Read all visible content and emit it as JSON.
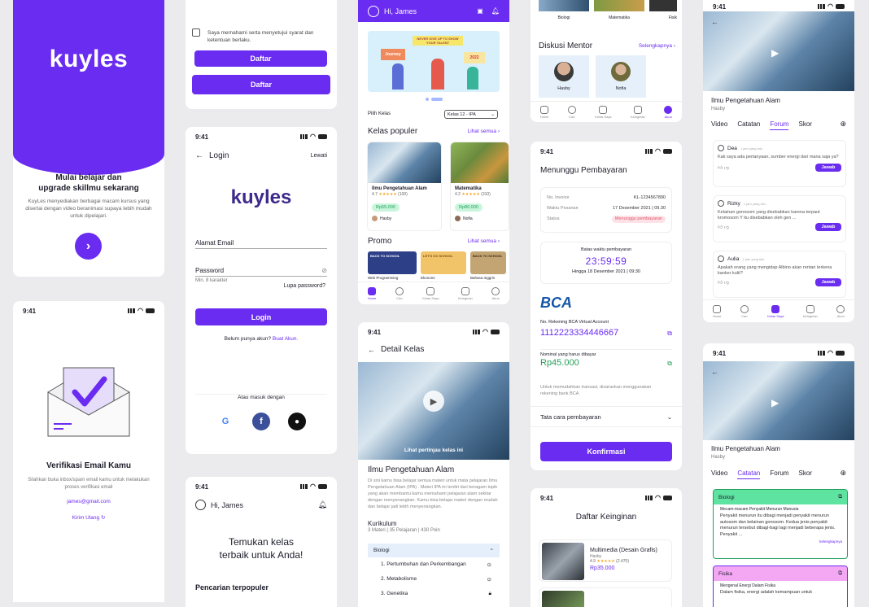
{
  "brand": {
    "logo_text": "kuyles",
    "primary": "#6a2cf1"
  },
  "status_time": "9:41",
  "splash": {
    "headline_1": "Mulai belajar dan",
    "headline_2": "upgrade skillmu sekarang",
    "body": "KuyLes menyediakan berbagai macam kursus yang disertai dengan video beranimasi supaya lebih mudah untuk dipelajari."
  },
  "verify": {
    "title": "Verifikasi Email Kamu",
    "body": "Silahkan buka inbox/spam email kamu untuk melakukan proses verifikasi email",
    "email": "james@gmail.com",
    "resend": "Kirim Ulang"
  },
  "register_tail": {
    "terms": "Saya memahami serta menyetujui syarat dan ketentuan berlaku.",
    "submit_outline": "Daftar",
    "submit": "Daftar"
  },
  "login": {
    "title": "Login",
    "skip": "Lewati",
    "email_label": "Alamat Email",
    "password_label": "Password",
    "password_hint": "Min. 8 karakter",
    "forgot": "Lupa password?",
    "submit": "Login",
    "no_account": "Belum punya akun?",
    "register_link": "Buat Akun.",
    "or_login": "Atau masuk dengan",
    "google": "G"
  },
  "onboard_home": {
    "greeting": "Hi, James",
    "headline_1": "Temukan kelas",
    "headline_2": "terbaik untuk Anda!",
    "section": "Pencarian terpopuler"
  },
  "home": {
    "greeting": "Hi, James",
    "banner_top": "NEVER GIVE UP TO SHOW YOUR TALENT",
    "banner_flag": "2022",
    "banner_sign": "Journey",
    "class_filter_label": "Pilih Kelas",
    "class_filter_value": "Kelas 12 - IPA",
    "popular_title": "Kelas populer",
    "see_all": "Lihat semua",
    "courses": [
      {
        "title": "Ilmu Pengetahuan Alam",
        "rating": "4.7",
        "reviews": "(100)",
        "price": "Rp55.000",
        "mentor": "Hasby"
      },
      {
        "title": "Matematika",
        "rating": "4.2",
        "reviews": "(310)",
        "price": "Rp80.000",
        "mentor": "Nofia"
      }
    ],
    "promo_title": "Promo",
    "promos": [
      "Web Programming",
      "Ekonomi",
      "Bahasa Inggris"
    ],
    "promo_art": [
      "BACK TO SCHOOL",
      "LET'S GO SCHOOL",
      "BACK TO SCHOOL"
    ],
    "nav": [
      "Home",
      "Cari",
      "Kelas Saya",
      "Keinginan",
      "Akun"
    ]
  },
  "detail": {
    "title": "Detail Kelas",
    "preview": "Lihat pertinjau kelas ini",
    "course": "Ilmu Pengetahuan Alam",
    "desc": "Di sini kamu bisa belajar semua materi untuk mata pelajaran Ilmu Pengetahuan Alam (IPA) . Materi IPA ini terdiri dari beragam topik yang akan membantu kamu memahami pelajaran alam sekitar dengan menyenangkan. Kamu bisa belajar materi dengan mudah dan belajar jadi lebih menyenangkan.",
    "curriculum": "Kurikulum",
    "curriculum_meta": "3 Materi | 35 Pelajaran | 430 Poin",
    "module": "Biologi",
    "lessons": [
      "1. Pertumbuhan dan Perkembangan",
      "2. Metabolisme",
      "3. Genetika"
    ]
  },
  "mentors": {
    "categories": [
      "Biologi",
      "Matematika",
      "Fisik"
    ],
    "title": "Diskusi Mentor",
    "see_all": "Selengkapnya",
    "people": [
      "Hasby",
      "Nofia"
    ],
    "nav": [
      "Home",
      "Cari",
      "Kelas Saya",
      "Keinginan",
      "Akun"
    ]
  },
  "payment": {
    "title": "Menunggu Pembayaran",
    "invoice_label": "No. Invoice",
    "invoice": "KL-1234567890",
    "order_label": "Waktu Pesanan",
    "order": "17 Desember 2021 | 09.30",
    "status_label": "Status",
    "status": "Menunggu pembayaran",
    "deadline_label": "Batas waktu pembayaran",
    "countdown": "23:59:59",
    "until": "Hingga 18 Desember 2021 | 09:30",
    "bank": "BCA",
    "va_label": "No. Rekening BCA Virtual Account",
    "va": "1112223334446667",
    "amount_label": "Nominal yang harus dibayar",
    "amount": "Rp45.000",
    "note": "Untuk memudahkan transasi, disarankan menggunakan rekening bank BCA",
    "howto": "Tata cara pembayaran",
    "confirm": "Konfirmasi"
  },
  "wishlist": {
    "title": "Daftar Keinginan",
    "item_title": "Multimedia (Desain Grafis)",
    "item_mentor": "Hasby",
    "item_rating": "4.9",
    "item_reviews": "(2.470)",
    "item_price": "Rp35.000"
  },
  "forum": {
    "course": "Ilmu Pengetahuan Alam",
    "mentor": "Hasby",
    "tabs": [
      "Video",
      "Catatan",
      "Forum",
      "Skor"
    ],
    "posts": [
      {
        "name": "Dea",
        "time": "1 jam yang lalu",
        "text": "Kak saya ada pertanyaan, sumber energi dari mana saja ya?"
      },
      {
        "name": "Rizky",
        "time": "1 jam yang lalu",
        "text": "Kelainan gonosom yang disebabkan karena terpaut kromosom Y itu disebabkan oleh gen ..."
      },
      {
        "name": "Aulia",
        "time": "1 jam yang lalu",
        "text": "Apakah orang yang mengidap Albino akan rentan terkena kanker kulit?"
      }
    ],
    "reply": "Jawab",
    "nav": [
      "Home",
      "Cari",
      "Kelas Saya",
      "Keinginan",
      "Akun"
    ]
  },
  "notes": {
    "course": "Ilmu Pengetahuan Alam",
    "mentor": "Hasby",
    "tabs": [
      "Video",
      "Catatan",
      "Forum",
      "Skor"
    ],
    "note1_title": "Biologi",
    "note1_sub": "Mecam-macam Penyakit Menurun Manusia",
    "note1_body": "Penyakit menurun itu dibagi menjadi penyakit menurun autosom dan kelainan gonosom. Kedua jenis penyakit menurun tersebut dibagi-bagi lagi menjadi beberapa jenis. Penyakit ...",
    "more": "Selengkapnya",
    "note2_title": "Fisika",
    "note2_sub": "Mengenal Energi Dalam Fisika",
    "note2_body": "Dalam fisika, energi adalah kemampuan untuk"
  }
}
